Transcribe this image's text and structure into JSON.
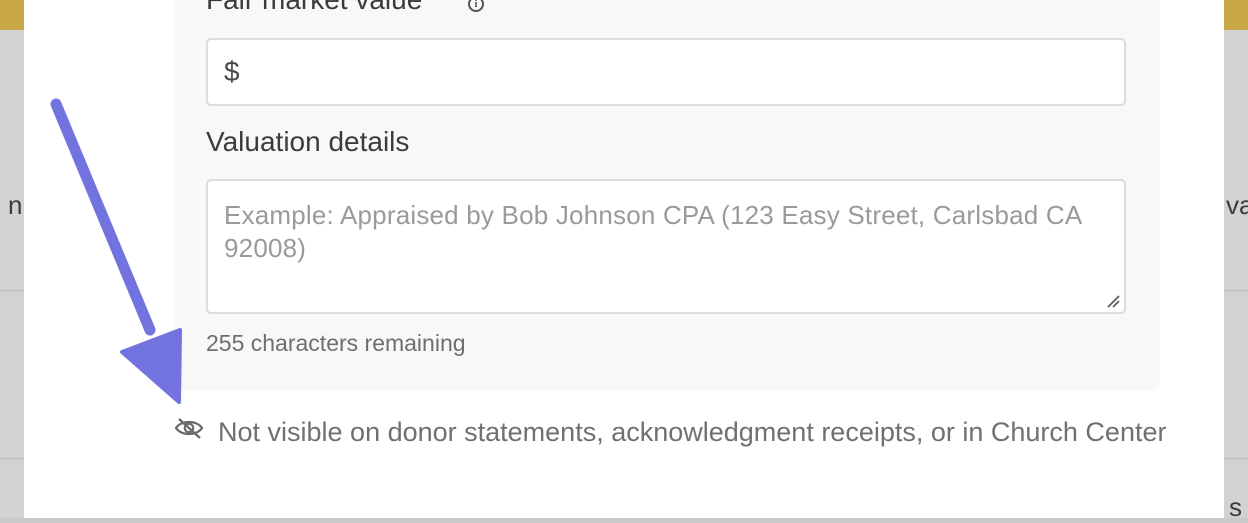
{
  "form": {
    "fair_market_value_label": "Fair market value",
    "fair_market_value_prefix": "$",
    "fair_market_value_value": "",
    "valuation_details_label": "Valuation details",
    "valuation_details_placeholder": "Example: Appraised by Bob Johnson CPA (123 Easy Street, Carlsbad CA 92008)",
    "characters_remaining": "255 characters remaining"
  },
  "notice": {
    "text": "Not visible on donor statements, acknowledgment receipts, or in Church Center",
    "icon": "eye-slash-icon"
  },
  "background": {
    "left_fragment": "n",
    "right_fragment": "va",
    "right_bottom_fragment": "s"
  },
  "annotation": {
    "arrow_color": "#7373e0"
  },
  "colors": {
    "accent_bar": "#c9a947",
    "input_border": "#dcdcdc",
    "section_bg": "#f8f8f8"
  }
}
